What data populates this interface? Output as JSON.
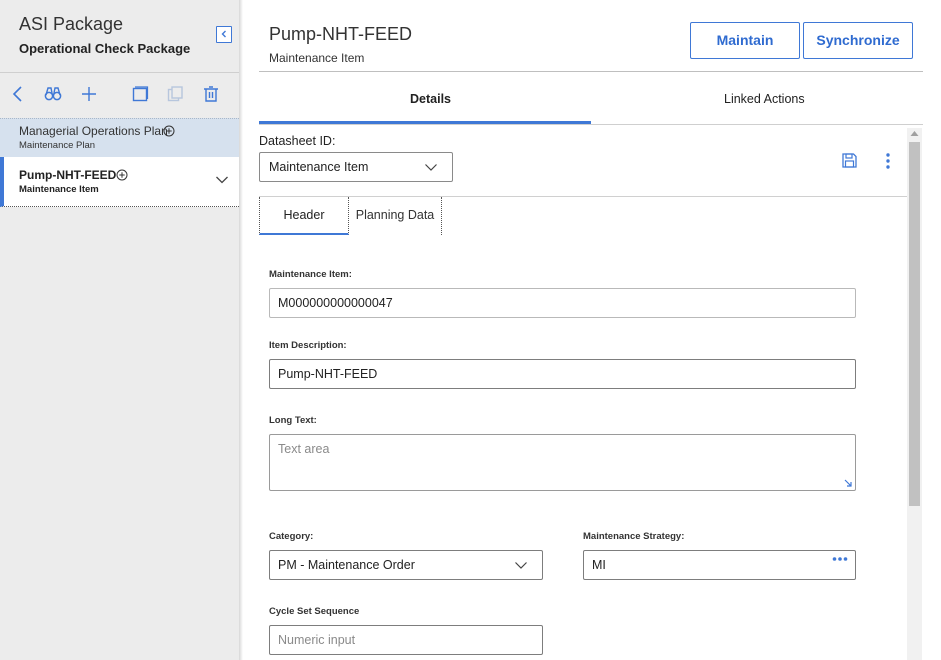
{
  "left_panel": {
    "package_title": "ASI Package",
    "package_subtitle": "Operational Check Package",
    "tree": [
      {
        "name": "Managerial Operations Plan",
        "type": "Maintenance Plan"
      },
      {
        "name": "Pump-NHT-FEED",
        "type": "Maintenance Item"
      }
    ]
  },
  "header": {
    "title": "Pump-NHT-FEED",
    "subtitle": "Maintenance Item",
    "maintain_label": "Maintain",
    "synchronize_label": "Synchronize"
  },
  "tabs": [
    "Details",
    "Linked Actions"
  ],
  "datasheet": {
    "label": "Datasheet ID:",
    "selected": "Maintenance Item"
  },
  "sub_tabs": [
    "Header",
    "Planning Data"
  ],
  "form": {
    "maintenance_item": {
      "label": "Maintenance Item:",
      "value": "M000000000000047"
    },
    "item_description": {
      "label": "Item Description:",
      "value": "Pump-NHT-FEED"
    },
    "long_text": {
      "label": "Long Text:",
      "placeholder": "Text area"
    },
    "category": {
      "label": "Category:",
      "value": "PM - Maintenance Order"
    },
    "maintenance_strategy": {
      "label": "Maintenance Strategy:",
      "value": "MI"
    },
    "cycle_set_sequence": {
      "label": "Cycle Set Sequence",
      "placeholder": "Numeric input"
    }
  },
  "colors": {
    "accent": "#3f78d6",
    "selected_row": "#d6e1ee",
    "panel_bg": "#ececec"
  },
  "icons": [
    "collapse-panel-icon",
    "back-arrow-icon",
    "binoculars-icon",
    "plus-icon",
    "copy-icon",
    "paste-icon",
    "trash-icon",
    "add-circle-icon",
    "chevron-down-icon",
    "save-icon",
    "kebab-menu-icon",
    "ellipsis-icon",
    "resize-handle-icon",
    "scroll-up-icon"
  ]
}
